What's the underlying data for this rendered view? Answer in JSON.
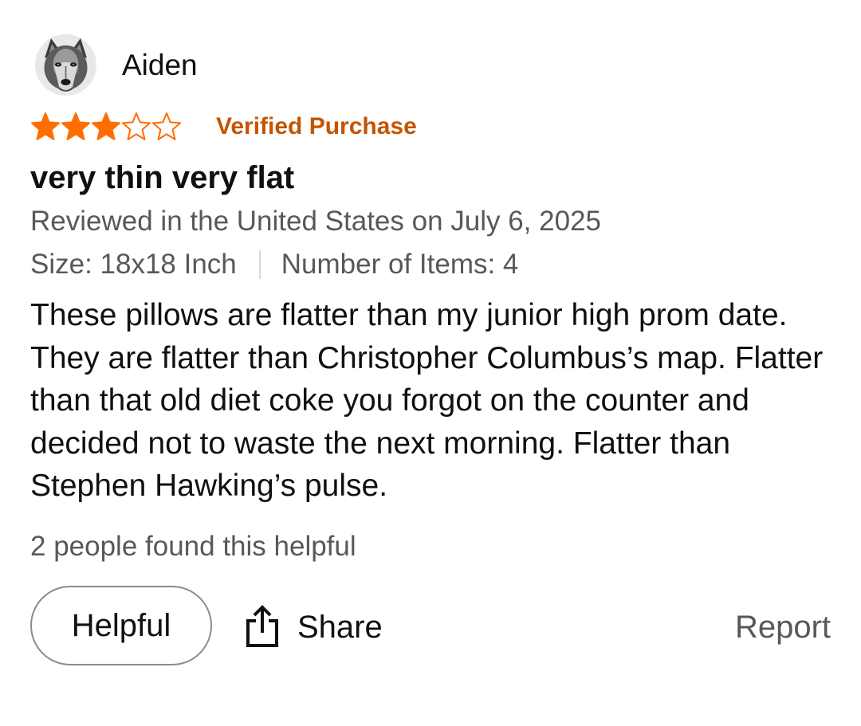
{
  "author": {
    "name": "Aiden",
    "avatar_icon": "wolf-avatar"
  },
  "rating": {
    "value": 3,
    "max": 5,
    "filled_color": "#ff6d00",
    "outline_color": "#ff6d00"
  },
  "badge": {
    "text": "Verified Purchase",
    "color": "#c45500"
  },
  "review": {
    "title": "very thin very flat",
    "reviewed_meta": "Reviewed in the United States on July 6, 2025",
    "size": "Size: 18x18 Inch",
    "items": "Number of Items: 4",
    "body": "These pillows are flatter than my junior high prom date. They are flatter than Christopher Columbus’s map. Flatter than that old diet coke you forgot on the counter and decided not to waste the next morning. Flatter than Stephen Hawking’s pulse.",
    "helpful_count": "2 people found this helpful"
  },
  "actions": {
    "helpful_label": "Helpful",
    "share_label": "Share",
    "share_icon": "share-icon",
    "report_label": "Report"
  }
}
